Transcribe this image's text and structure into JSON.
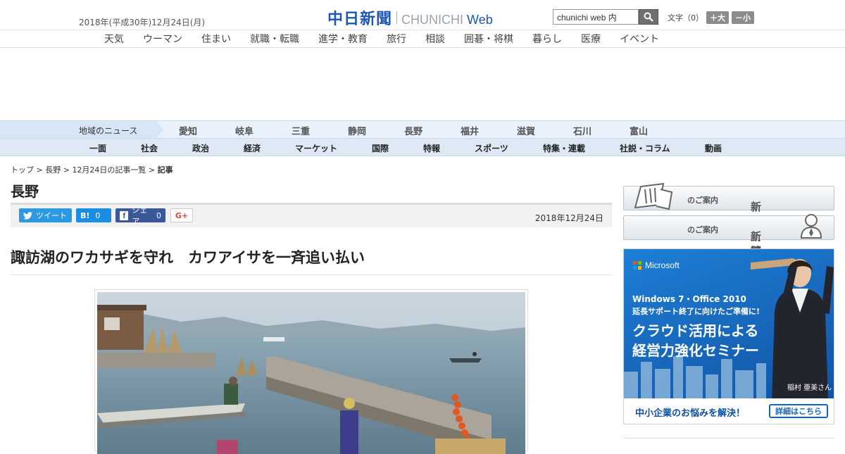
{
  "header": {
    "date": "2018年(平成30年)12月24日(月)",
    "logo_jp": "中日新聞",
    "logo_en_1": "CHUNICHI",
    "logo_en_2": "Web",
    "search_value": "chunichi web 内",
    "fontsize_label": "文字（0）",
    "fontsize_up": "＋大",
    "fontsize_down": "－小"
  },
  "service_nav": [
    "天気",
    "ウーマン",
    "住まい",
    "就職・転職",
    "進学・教育",
    "旅行",
    "相談",
    "囲碁・将棋",
    "暮らし",
    "医療",
    "イベント"
  ],
  "region_nav": {
    "heading": "地域のニュース",
    "items": [
      "愛知",
      "岐阜",
      "三重",
      "静岡",
      "長野",
      "福井",
      "滋賀",
      "石川",
      "富山"
    ]
  },
  "category_nav": [
    "一面",
    "社会",
    "政治",
    "経済",
    "マーケット",
    "国際",
    "特報",
    "スポーツ",
    "特集・連載",
    "社説・コラム",
    "動画"
  ],
  "breadcrumb": {
    "top": "トップ",
    "sep1": " > ",
    "region": "長野",
    "sep2": " > ",
    "list": "12月24日の記事一覧",
    "sep3": " > ",
    "current": "記事"
  },
  "article": {
    "section": "長野",
    "date": "2018年12月24日",
    "headline": "諏訪湖のワカサギを守れ　カワアイサを一斉追い払い"
  },
  "share": {
    "tweet": "ツイート",
    "hatena_icon": "B!",
    "hatena_count": "0",
    "fb_label": "シェア",
    "fb_count": "0",
    "gplus": "G+"
  },
  "sidebar": {
    "subscribe_main": "新聞購読",
    "subscribe_sub": "のご案内",
    "ads_main": "新聞広告出稿",
    "ads_sub": "のご案内"
  },
  "ad": {
    "brand": "Microsoft",
    "line1": "Windows 7・Office 2010",
    "line2": "延長サポート終了に向けたご準備に!",
    "line3a": "クラウド活用による",
    "line3b": "経営力強化セミナー",
    "person": "稲村 亜美さん",
    "footer": "中小企業のお悩みを解決！",
    "button": "詳細はこちら"
  }
}
